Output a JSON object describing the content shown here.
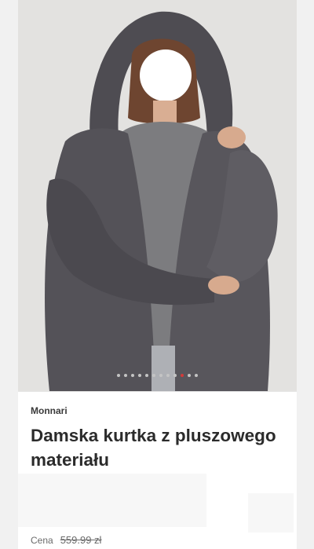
{
  "gallery": {
    "image_description_icon": "product-photo",
    "dot_count": 12,
    "active_index": 9,
    "active_color": "#d43a3a",
    "inactive_color": "#c4c4c4"
  },
  "product": {
    "brand": "Monnari",
    "title": "Damska kurtka z pluszowego materiału",
    "price_label": "Cena",
    "price_value": "559.99 zł"
  }
}
